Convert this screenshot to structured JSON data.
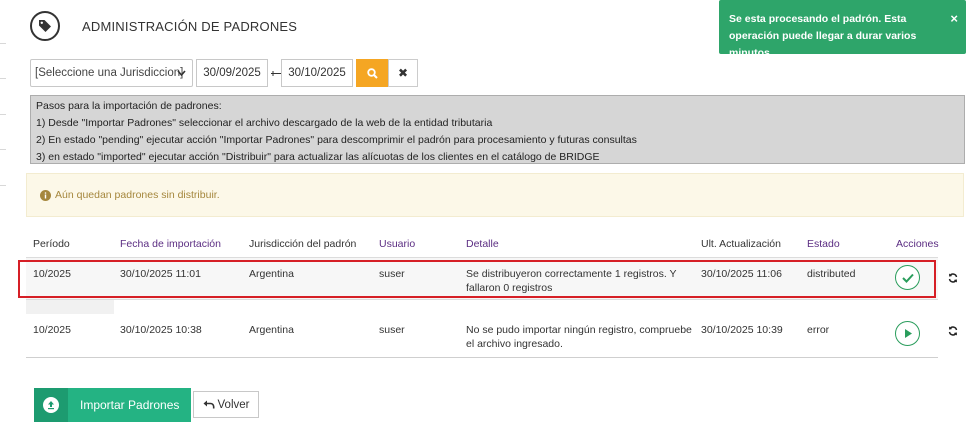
{
  "header": {
    "title": "ADMINISTRACIÓN DE PADRONES",
    "icon": "tag-icon"
  },
  "toast": {
    "message": "Se esta procesando el padrón. Esta operación puede llegar a durar varios minutos.",
    "close": "×",
    "color": "#2ea56a"
  },
  "filters": {
    "jurisdiction_selected": "[Seleccione una Jurisdiccion]",
    "date_from": "30/09/2025",
    "date_to": "30/10/2025",
    "clear": "✖"
  },
  "steps": {
    "title": "Pasos para la importación de padrones:",
    "items": [
      "1) Desde \"Importar Padrones\" seleccionar el archivo descargado de la web de la entidad tributaria",
      "2) En estado \"pending\" ejecutar acción \"Importar Padrones\" para descomprimir el padrón para procesamiento y futuras consultas",
      "3) en estado \"imported\" ejecutar acción \"Distribuir\" para actualizar las alícuotas de los clientes en el catálogo de BRIDGE"
    ]
  },
  "alert": {
    "text": "Aún quedan padrones sin distribuir."
  },
  "table": {
    "columns": [
      "Período",
      "Fecha de importación",
      "Jurisdicción del padrón",
      "Usuario",
      "Detalle",
      "Ult. Actualización",
      "Estado",
      "Acciones"
    ],
    "rows": [
      {
        "periodo": "10/2025",
        "fecha": "30/10/2025 11:01",
        "jurisdiccion": "Argentina",
        "usuario": "suser",
        "detalle_1": "Se distribuyeron correctamente 1 registros. Y",
        "detalle_2": "fallaron 0 registros",
        "actualizacion": "30/10/2025 11:06",
        "estado": "distributed",
        "accion_icon": "check-icon"
      },
      {
        "periodo": "10/2025",
        "fecha": "30/10/2025 10:38",
        "jurisdiccion": "Argentina",
        "usuario": "suser",
        "detalle_1": "No se pudo importar ningún registro, compruebe",
        "detalle_2": "el archivo ingresado.",
        "actualizacion": "30/10/2025 10:39",
        "estado": "error",
        "accion_icon": "play-icon"
      }
    ]
  },
  "buttons": {
    "import": "Importar Padrones",
    "back": "Volver"
  },
  "colors": {
    "accent": "#24b383",
    "search": "#f5a623",
    "highlight": "#d61f26",
    "header_purple": "#5b2d82"
  }
}
